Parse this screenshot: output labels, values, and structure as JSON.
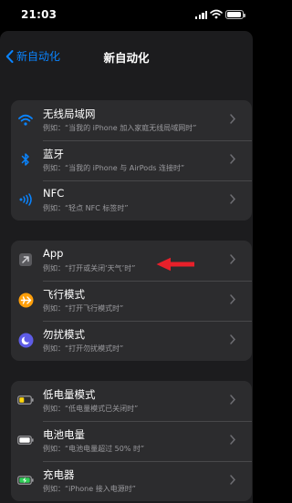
{
  "status": {
    "time": "21:03"
  },
  "nav": {
    "back_label": "新自动化",
    "title": "新自动化"
  },
  "groups": [
    {
      "items": [
        {
          "title": "无线局域网",
          "subtitle": "例如：“当我的 iPhone 加入家庭无线局域网时”",
          "icon": "wifi-icon"
        },
        {
          "title": "蓝牙",
          "subtitle": "例如：“当我的 iPhone 与 AirPods 连接时”",
          "icon": "bluetooth-icon"
        },
        {
          "title": "NFC",
          "subtitle": "例如：“轻点 NFC 标签时”",
          "icon": "nfc-icon"
        }
      ]
    },
    {
      "items": [
        {
          "title": "App",
          "subtitle": "例如：“打开或关闭‘天气’时”",
          "icon": "app-icon"
        },
        {
          "title": "飞行模式",
          "subtitle": "例如：“打开飞行模式时”",
          "icon": "airplane-icon"
        },
        {
          "title": "勿扰模式",
          "subtitle": "例如：“打开勿扰模式时”",
          "icon": "moon-icon"
        }
      ]
    },
    {
      "items": [
        {
          "title": "低电量模式",
          "subtitle": "例如：“低电量模式已关闭时”",
          "icon": "low-battery-icon"
        },
        {
          "title": "电池电量",
          "subtitle": "例如：“电池电量超过 50% 时”",
          "icon": "battery-level-icon"
        },
        {
          "title": "充电器",
          "subtitle": "例如：“iPhone 接入电源时”",
          "icon": "charger-icon"
        }
      ]
    }
  ],
  "colors": {
    "accent": "#0a84ff",
    "annotation_arrow": "#e8202a",
    "airplane": "#ff9f0a",
    "moon": "#5e5ce6",
    "low_power": "#ffd60a",
    "charging": "#30d158"
  }
}
